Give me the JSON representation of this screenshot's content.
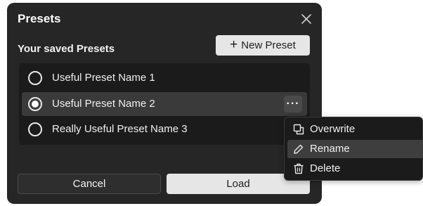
{
  "dialog": {
    "title": "Presets",
    "subtitle": "Your saved Presets",
    "new_preset_plus": "+",
    "new_preset_label": "New Preset",
    "cancel_label": "Cancel",
    "load_label": "Load"
  },
  "presets": [
    {
      "name": "Useful Preset Name 1",
      "selected": false
    },
    {
      "name": "Useful Preset Name 2",
      "selected": true
    },
    {
      "name": "Really Useful Preset Name 3",
      "selected": false
    }
  ],
  "more_button_label": "···",
  "context_menu": {
    "items": [
      {
        "label": "Overwrite",
        "icon": "copy-icon"
      },
      {
        "label": "Rename",
        "icon": "pencil-icon",
        "hovered": true
      },
      {
        "label": "Delete",
        "icon": "trash-icon"
      }
    ]
  },
  "colors": {
    "dialog_bg": "#262626",
    "list_bg": "#1b1b1b",
    "selected_row_bg": "#3a3a3a",
    "primary_button_bg": "#e6e6e6"
  }
}
